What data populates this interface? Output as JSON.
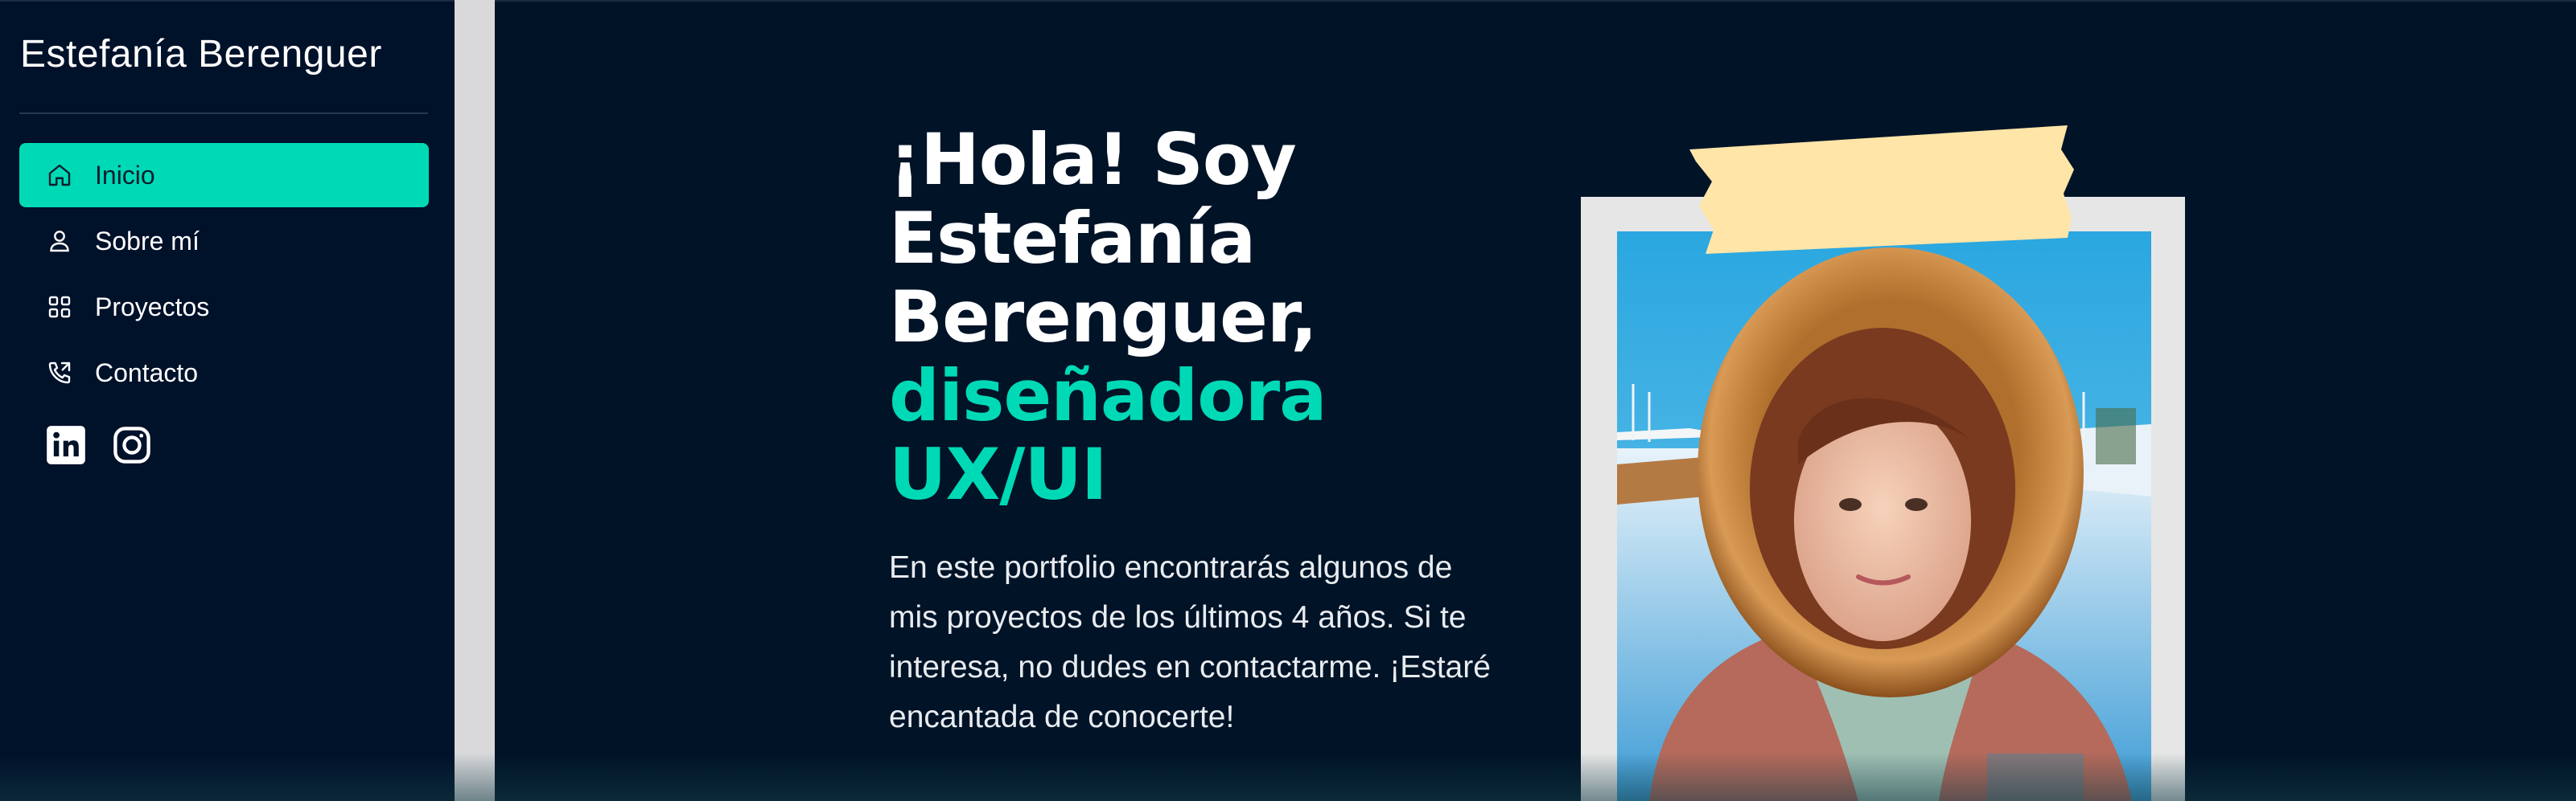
{
  "sidebar": {
    "brand": "Estefanía Berenguer",
    "nav": [
      {
        "label": "Inicio",
        "icon": "home-icon",
        "active": true
      },
      {
        "label": "Sobre mí",
        "icon": "user-icon",
        "active": false
      },
      {
        "label": "Proyectos",
        "icon": "grid-icon",
        "active": false
      },
      {
        "label": "Contacto",
        "icon": "phone-icon",
        "active": false
      }
    ],
    "socials": [
      {
        "icon": "linkedin-icon"
      },
      {
        "icon": "instagram-icon"
      }
    ]
  },
  "hero": {
    "heading_lines": [
      "¡Hola! Soy",
      "Estefanía",
      "Berenguer,"
    ],
    "accent_lines": [
      "diseñadora",
      "UX/UI"
    ],
    "intro": "En este portfolio encontrarás algunos de mis proyectos de los últimos 4 años. Si te interesa, no dudes en contactarme. ¡Estaré encantada de conocerte!"
  },
  "colors": {
    "background": "#001327",
    "accent": "#00d9b6",
    "tape": "#ffe5a8",
    "text": "#ffffff"
  }
}
